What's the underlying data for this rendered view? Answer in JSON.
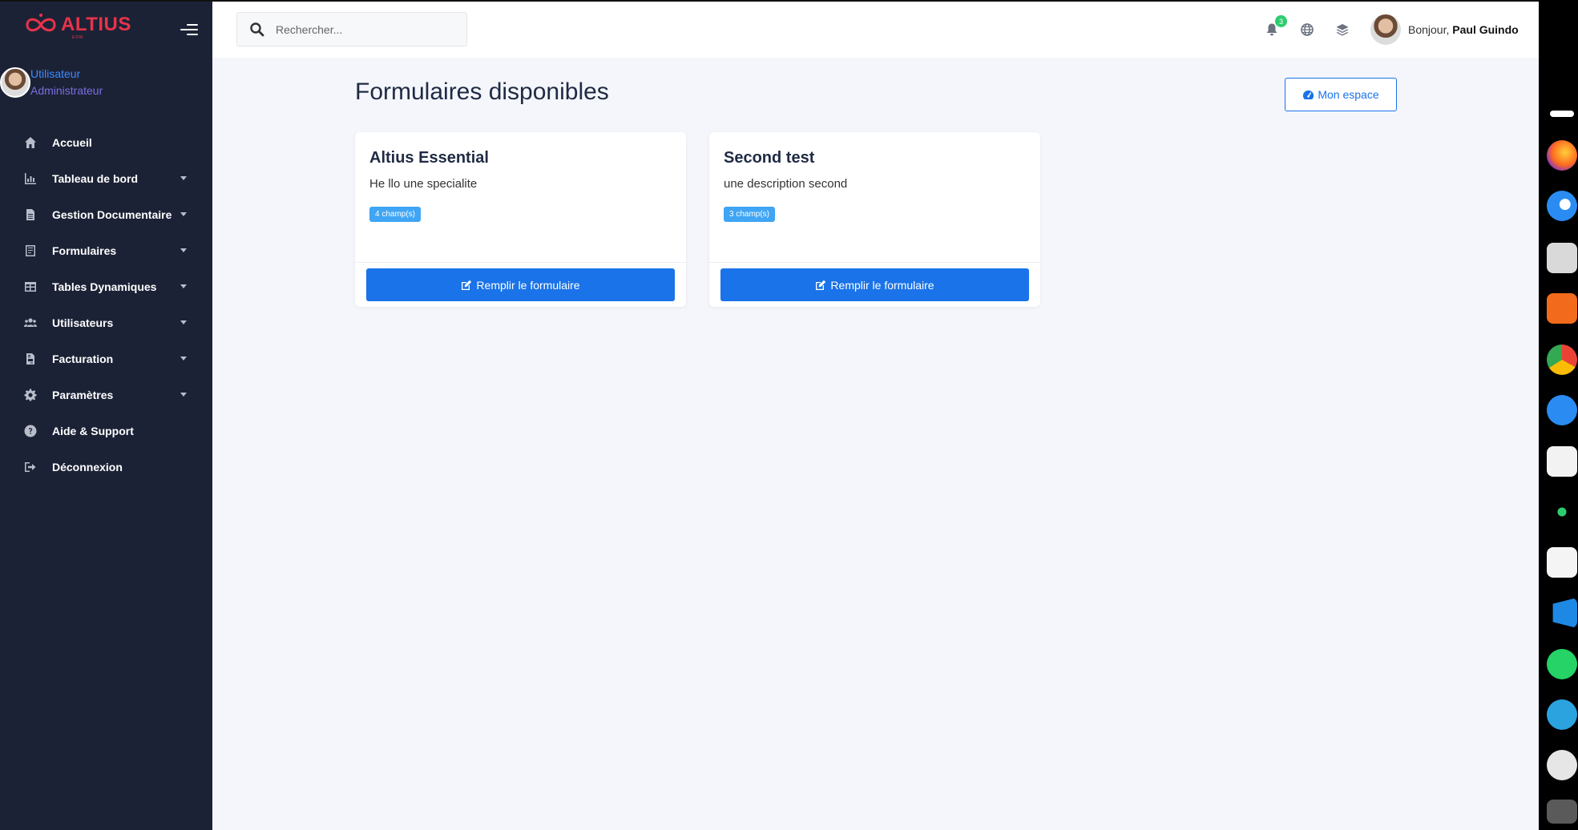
{
  "brand": {
    "name": "ALTIUS",
    "sub": "EDM",
    "color": "#e8334a"
  },
  "user": {
    "role": "Utilisateur",
    "title": "Administrateur"
  },
  "nav": [
    {
      "label": "Accueil",
      "icon": "home-icon",
      "caret": false
    },
    {
      "label": "Tableau de bord",
      "icon": "chart-icon",
      "caret": true
    },
    {
      "label": "Gestion Documentaire",
      "icon": "file-icon",
      "caret": true
    },
    {
      "label": "Formulaires",
      "icon": "form-icon",
      "caret": true
    },
    {
      "label": "Tables Dynamiques",
      "icon": "table-icon",
      "caret": true
    },
    {
      "label": "Utilisateurs",
      "icon": "users-icon",
      "caret": true
    },
    {
      "label": "Facturation",
      "icon": "invoice-icon",
      "caret": true
    },
    {
      "label": "Paramètres",
      "icon": "gear-icon",
      "caret": true
    },
    {
      "label": "Aide & Support",
      "icon": "help-icon",
      "caret": false
    },
    {
      "label": "Déconnexion",
      "icon": "logout-icon",
      "caret": false
    }
  ],
  "topbar": {
    "search_placeholder": "Rechercher...",
    "notifications_count": "3",
    "greeting": "Bonjour,",
    "user_name": "Paul Guindo"
  },
  "page": {
    "title": "Formulaires disponibles",
    "space_button": "Mon espace"
  },
  "cards": [
    {
      "title": "Altius Essential",
      "description": "He llo une specialite",
      "fields": "4 champ(s)",
      "button": "Remplir le formulaire"
    },
    {
      "title": "Second test",
      "description": "une description second",
      "fields": "3 champ(s)",
      "button": "Remplir le formulaire"
    }
  ],
  "colors": {
    "sidebar": "#1c2236",
    "primary": "#1a73e8",
    "badge": "#3fa5f4",
    "notification": "#2dcd6f"
  },
  "dock": [
    "firefox-icon",
    "thunderbird-icon",
    "files-icon",
    "app-store-icon",
    "chrome-icon",
    "help-icon",
    "gimp-icon",
    "apps-grid-icon",
    "xournal-icon",
    "vscode-icon",
    "whatsapp-icon",
    "telegram-icon",
    "clock-icon",
    "trash-icon"
  ]
}
